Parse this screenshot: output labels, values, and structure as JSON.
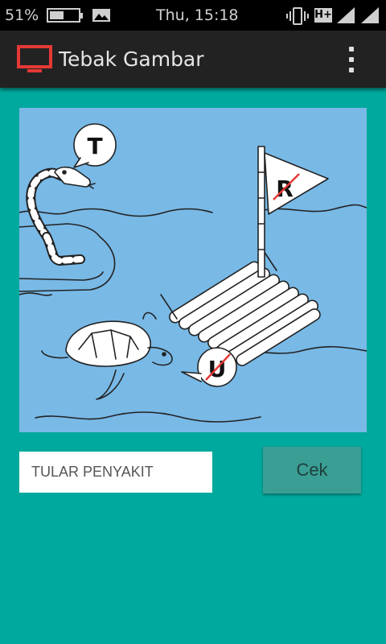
{
  "status_bar": {
    "battery_percent": "51%",
    "battery_level": 0.51,
    "time": "Thu, 15:18",
    "network_type": "H+",
    "icons": [
      "battery-icon",
      "gallery-icon",
      "vibrate-icon",
      "signal-icon",
      "signal-icon"
    ]
  },
  "app_bar": {
    "title": "Tebak Gambar",
    "app_icon": "tv-icon",
    "menu_icon": "overflow-menu-icon"
  },
  "puzzle": {
    "bubble_letters": [
      "T",
      "R",
      "U"
    ],
    "crossed_letters": [
      "R",
      "U"
    ]
  },
  "answer": {
    "value": "TULAR PENYAKIT",
    "placeholder": ""
  },
  "check_button": {
    "label": "Cek"
  },
  "colors": {
    "background": "#00a99d",
    "app_bar": "#222222",
    "puzzle_background": "#78b9e6",
    "button": "#3a9e94",
    "app_icon": "#e53935",
    "strike": "#e53935"
  }
}
